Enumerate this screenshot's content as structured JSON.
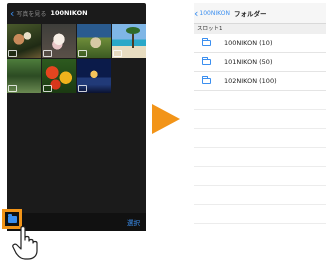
{
  "left_screen": {
    "back_label": "写真を見る",
    "title": "100NIKON",
    "select_label": "選択",
    "thumbnails": [
      "photo-person-bird",
      "photo-flowers",
      "photo-building",
      "photo-beach",
      "photo-garden",
      "photo-red-flowers",
      "photo-night-city"
    ]
  },
  "right_screen": {
    "back_label": "100NIKON",
    "title": "フォルダー",
    "section_label": "スロット1",
    "folders": [
      {
        "label": "100NIKON (10)"
      },
      {
        "label": "101NIKON (50)"
      },
      {
        "label": "102NIKON (100)"
      }
    ]
  },
  "colors": {
    "accent": "#3b8ff0",
    "highlight": "#f29418"
  }
}
